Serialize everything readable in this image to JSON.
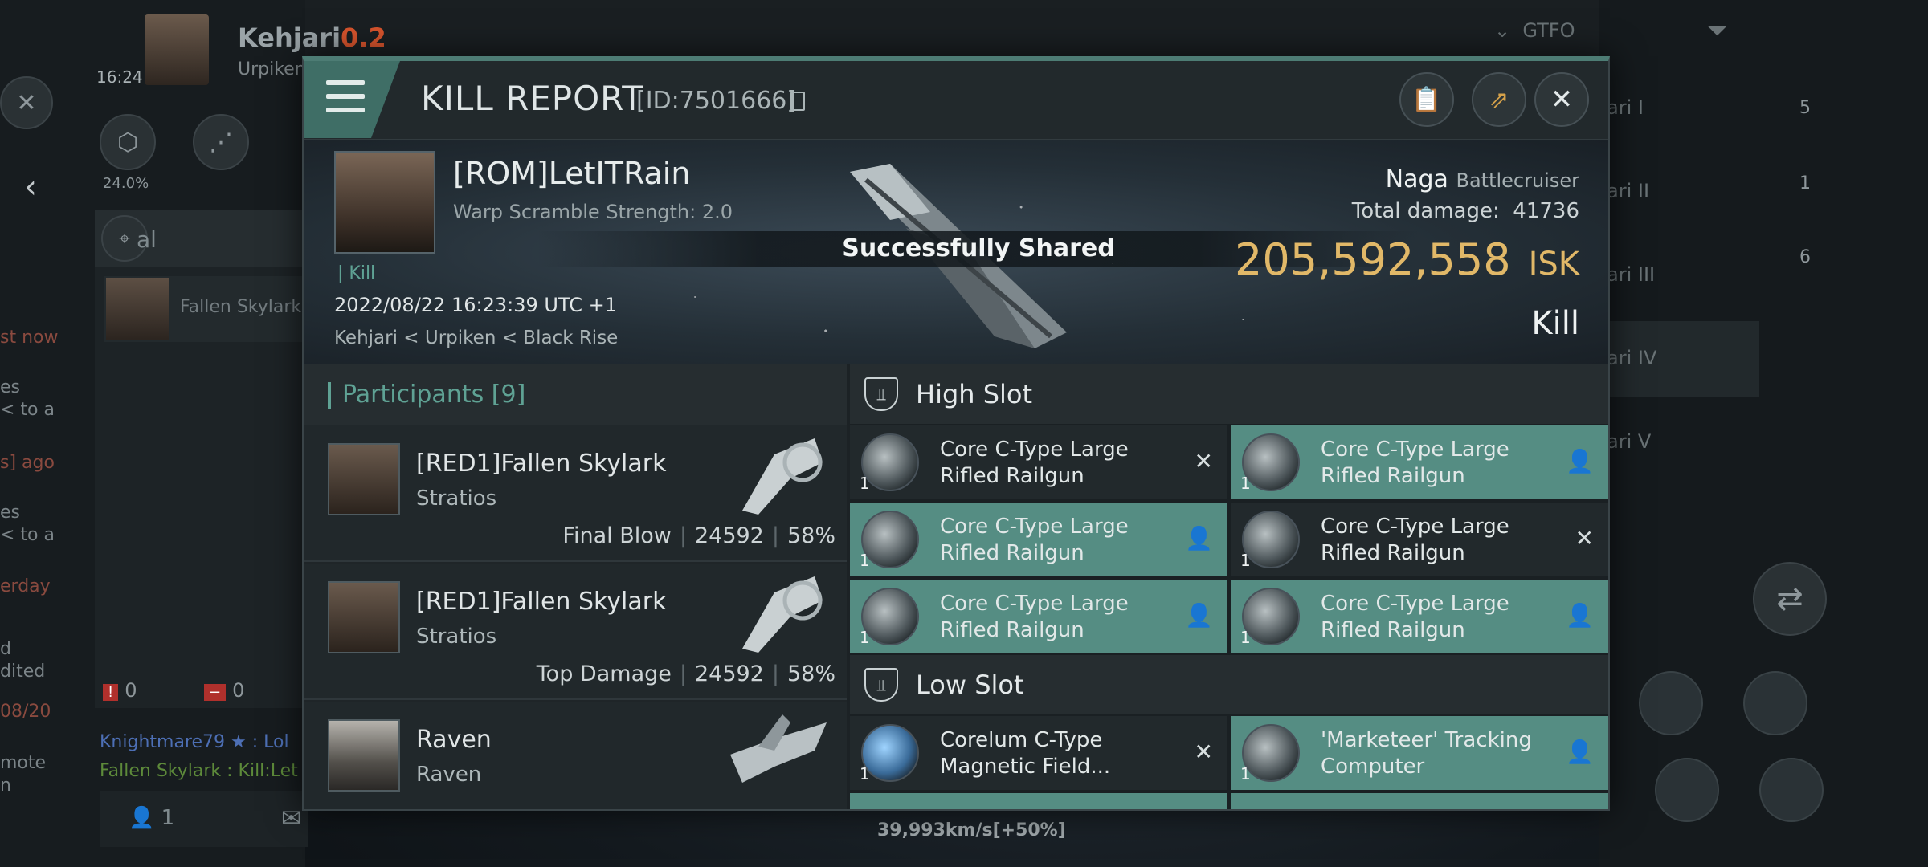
{
  "background": {
    "pilot": {
      "name": "Kehjari",
      "security": "0.2",
      "corp": "Urpiken",
      "time": "16:24"
    },
    "pct": "24.0%",
    "chat": {
      "channel_partial": "al",
      "member": "Fallen Skylark",
      "counter_a": "0",
      "counter_b": "0",
      "line1": "Knightmare79 ★ : Lol",
      "line2": "Fallen Skylark : Kill:Let",
      "frag_1": "st now",
      "frag_2": "es",
      "frag_3": "< to a",
      "frag_4": "s] ago",
      "frag_5": "es",
      "frag_6": "< to a",
      "frag_7": "erday",
      "frag_8": "d",
      "frag_9": "dited",
      "frag_10": "08/20",
      "frag_11": "mote",
      "frag_12": "n",
      "online": "1"
    },
    "speed": "39,993km/s[+50%]",
    "filter": "GTFO",
    "right_list": [
      "ari I",
      "ari II",
      "ari III",
      "ari IV",
      "ari V"
    ],
    "right_counts": [
      "5",
      "1",
      "6"
    ]
  },
  "header": {
    "title": "KILL REPORT",
    "id": "[ID:7501666]"
  },
  "victim": {
    "name": "[ROM]LetITRain",
    "warp_scramble": "Warp Scramble Strength: 2.0",
    "tag": "| Kill",
    "datetime": "2022/08/22 16:23:39 UTC +1",
    "affiliation": "Kehjari < Urpiken < Black Rise",
    "ship": "Naga",
    "ship_class": "Battlecruiser",
    "total_damage_label": "Total damage:",
    "total_damage": "41736",
    "isk_value": "205,592,558",
    "isk_unit": "ISK",
    "result": "Kill"
  },
  "toast": "Successfully Shared",
  "participants": {
    "label": "Participants",
    "count": "[9]",
    "rows": [
      {
        "name": "[RED1]Fallen Skylark",
        "ship": "Stratios",
        "role": "Final Blow",
        "damage": "24592",
        "percent": "58%"
      },
      {
        "name": "[RED1]Fallen Skylark",
        "ship": "Stratios",
        "role": "Top Damage",
        "damage": "24592",
        "percent": "58%"
      },
      {
        "name": "Raven",
        "ship": "Raven",
        "role": "",
        "damage": "",
        "percent": ""
      }
    ]
  },
  "high_slot": {
    "label": "High Slot",
    "modules": [
      {
        "qty": "1",
        "name": "Core C-Type Large Rifled Railgun",
        "state": "destroyed",
        "mark": "✕"
      },
      {
        "qty": "1",
        "name": "Core C-Type Large Rifled Railgun",
        "state": "dropped",
        "mark": "👤"
      },
      {
        "qty": "1",
        "name": "Core C-Type Large Rifled Railgun",
        "state": "dropped",
        "mark": "👤"
      },
      {
        "qty": "1",
        "name": "Core C-Type Large Rifled Railgun",
        "state": "destroyed",
        "mark": "✕"
      },
      {
        "qty": "1",
        "name": "Core C-Type Large Rifled Railgun",
        "state": "dropped",
        "mark": "👤"
      },
      {
        "qty": "1",
        "name": "Core C-Type Large Rifled Railgun",
        "state": "dropped",
        "mark": "👤"
      }
    ]
  },
  "low_slot": {
    "label": "Low Slot",
    "modules": [
      {
        "qty": "1",
        "name": "Corelum C-Type Magnetic Field...",
        "state": "destroyed",
        "mark": "✕"
      },
      {
        "qty": "1",
        "name": "'Marketeer' Tracking Computer",
        "state": "dropped",
        "mark": "👤"
      }
    ]
  },
  "colors": {
    "accent": "#558d83",
    "isk": "#e1b868",
    "kill_tag": "#5fa294"
  }
}
